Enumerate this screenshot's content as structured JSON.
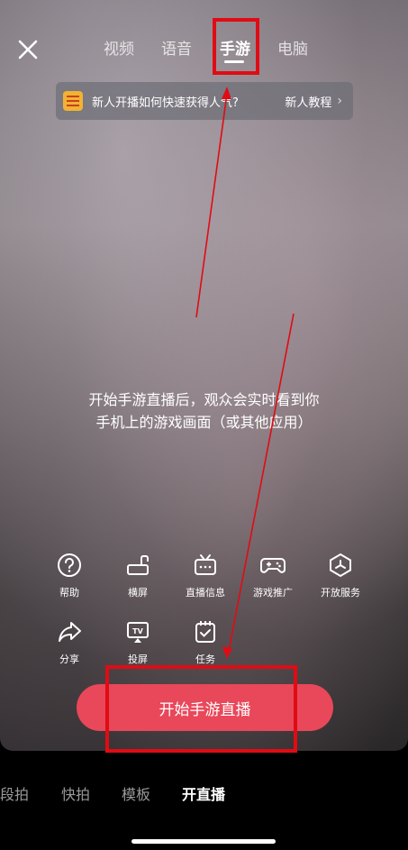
{
  "tabs": [
    {
      "label": "视频",
      "active": false
    },
    {
      "label": "语音",
      "active": false
    },
    {
      "label": "手游",
      "active": true
    },
    {
      "label": "电脑",
      "active": false
    }
  ],
  "banner": {
    "text": "新人开播如何快速获得人气?",
    "link": "新人教程",
    "chevron": "›"
  },
  "center_message": {
    "line1": "开始手游直播后，观众会实时看到你",
    "line2": "手机上的游戏画面（或其他应用）"
  },
  "tools_row1": [
    {
      "label": "帮助",
      "icon": "help-icon"
    },
    {
      "label": "横屏",
      "icon": "landscape-icon"
    },
    {
      "label": "直播信息",
      "icon": "tv-info-icon"
    },
    {
      "label": "游戏推广",
      "icon": "gamepad-icon"
    },
    {
      "label": "开放服务",
      "icon": "open-service-icon"
    }
  ],
  "tools_row2": [
    {
      "label": "分享",
      "icon": "share-icon"
    },
    {
      "label": "投屏",
      "icon": "cast-tv-icon"
    },
    {
      "label": "任务",
      "icon": "task-icon"
    }
  ],
  "start_button": "开始手游直播",
  "bottom_nav": [
    {
      "label": "段拍",
      "active": false
    },
    {
      "label": "快拍",
      "active": false
    },
    {
      "label": "模板",
      "active": false
    },
    {
      "label": "开直播",
      "active": true
    }
  ],
  "colors": {
    "accent": "#e9475a",
    "annotation": "#e10b14"
  }
}
